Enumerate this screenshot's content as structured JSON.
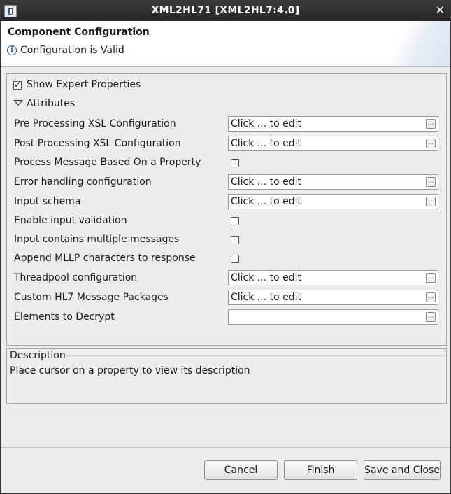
{
  "window": {
    "title": "XML2HL71 [XML2HL7:4.0]"
  },
  "header": {
    "title": "Component Configuration",
    "status": "Configuration is Valid"
  },
  "expert": {
    "label": "Show Expert Properties",
    "checked": true
  },
  "attributes": {
    "label": "Attributes"
  },
  "properties": [
    {
      "label": "Pre Processing XSL Configuration",
      "type": "text",
      "value": "Click ... to edit"
    },
    {
      "label": "Post Processing XSL Configuration",
      "type": "text",
      "value": "Click ... to edit"
    },
    {
      "label": "Process Message Based On a Property",
      "type": "checkbox",
      "checked": false
    },
    {
      "label": "Error handling configuration",
      "type": "text",
      "value": "Click ... to edit"
    },
    {
      "label": "Input schema",
      "type": "text",
      "value": "Click ... to edit"
    },
    {
      "label": "Enable input validation",
      "type": "checkbox",
      "checked": false
    },
    {
      "label": "Input contains multiple messages",
      "type": "checkbox",
      "checked": false
    },
    {
      "label": "Append MLLP characters to response",
      "type": "checkbox",
      "checked": false
    },
    {
      "label": "Threadpool configuration",
      "type": "text",
      "value": "Click ... to edit"
    },
    {
      "label": "Custom HL7 Message Packages",
      "type": "text",
      "value": "Click ... to edit"
    },
    {
      "label": "Elements to Decrypt",
      "type": "text",
      "value": ""
    }
  ],
  "description": {
    "title": "Description",
    "text": "Place cursor on a property to view its description"
  },
  "buttons": {
    "cancel": "Cancel",
    "finish": "Finish",
    "save_close": "Save and Close"
  },
  "icons": {
    "app": "app-icon",
    "close": "close-icon",
    "info": "info-icon",
    "browse": "browse-dots-icon"
  }
}
